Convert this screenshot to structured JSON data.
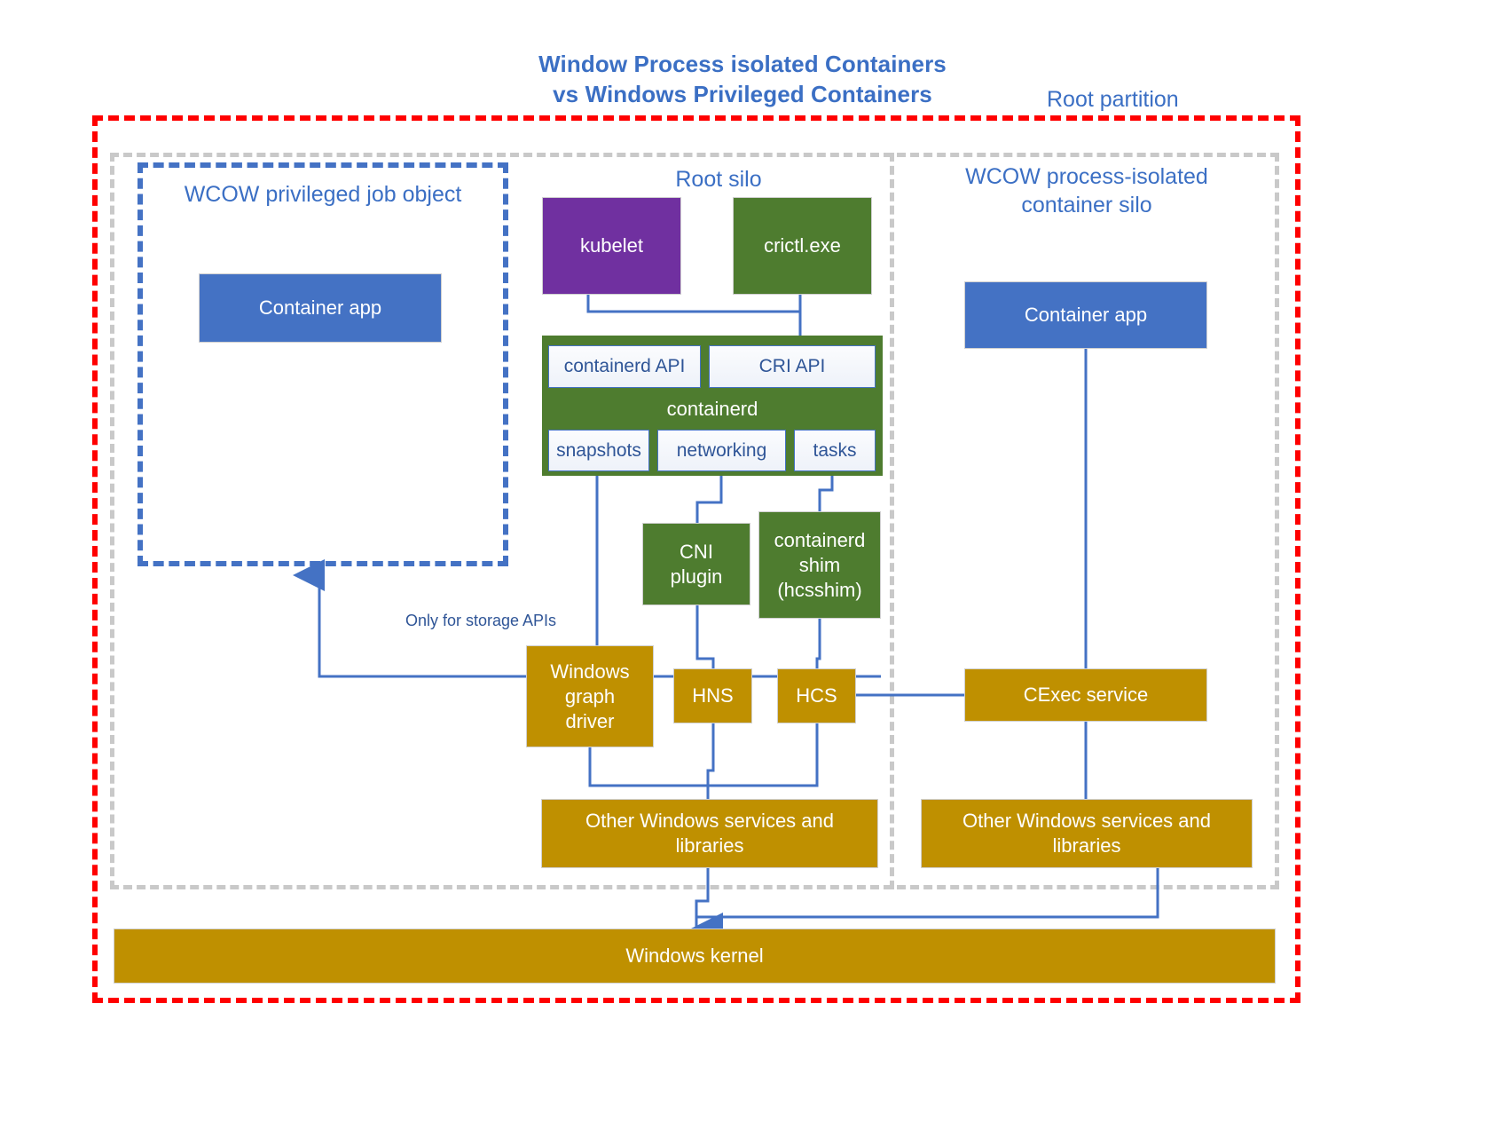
{
  "title": {
    "line1": "Window Process isolated Containers",
    "line2": "vs Windows Privileged Containers"
  },
  "partitions": {
    "root_partition_label": "Root partition",
    "job_object_title": "WCOW privileged job object",
    "root_silo_title": "Root silo",
    "isolated_silo_title": "WCOW process-isolated\ncontainer silo"
  },
  "colors": {
    "accent_blue": "#4472c4",
    "title_blue": "#3b6fc4",
    "purple": "#7030a0",
    "green": "#4e7c2f",
    "gold": "#bf9000",
    "red_dash": "#ff0000",
    "gray_dash": "#c9c9c9",
    "connector": "#4472c4"
  },
  "boxes": {
    "container_app_left": "Container app",
    "kubelet": "kubelet",
    "crictl": "crictl.exe",
    "containerd": "containerd",
    "containerd_api": "containerd API",
    "cri_api": "CRI API",
    "snapshots": "snapshots",
    "networking": "networking",
    "tasks": "tasks",
    "cni_plugin": "CNI\nplugin",
    "containerd_shim": "containerd\nshim\n(hcsshim)",
    "windows_graph_driver": "Windows\ngraph\ndriver",
    "hns": "HNS",
    "hcs": "HCS",
    "other_services_left": "Other Windows services and\nlibraries",
    "container_app_right": "Container app",
    "cexec_service": "CExec service",
    "other_services_right": "Other Windows services and\nlibraries",
    "windows_kernel": "Windows kernel"
  },
  "annotations": {
    "storage_apis": "Only for storage APIs"
  },
  "chart_data": {
    "type": "diagram",
    "title": "Window Process isolated Containers vs Windows Privileged Containers",
    "nodes": [
      {
        "id": "container_app_left",
        "label": "Container app",
        "group": "WCOW privileged job object",
        "color": "#4472c4"
      },
      {
        "id": "kubelet",
        "label": "kubelet",
        "group": "Root silo",
        "color": "#7030a0"
      },
      {
        "id": "crictl",
        "label": "crictl.exe",
        "group": "Root silo",
        "color": "#4e7c2f"
      },
      {
        "id": "containerd",
        "label": "containerd",
        "group": "Root silo",
        "color": "#4e7c2f"
      },
      {
        "id": "containerd_api",
        "label": "containerd API",
        "group": "containerd",
        "color": "#eef2f9"
      },
      {
        "id": "cri_api",
        "label": "CRI API",
        "group": "containerd",
        "color": "#eef2f9"
      },
      {
        "id": "snapshots",
        "label": "snapshots",
        "group": "containerd",
        "color": "#eef2f9"
      },
      {
        "id": "networking",
        "label": "networking",
        "group": "containerd",
        "color": "#eef2f9"
      },
      {
        "id": "tasks",
        "label": "tasks",
        "group": "containerd",
        "color": "#eef2f9"
      },
      {
        "id": "cni_plugin",
        "label": "CNI plugin",
        "group": "Root silo",
        "color": "#4e7c2f"
      },
      {
        "id": "containerd_shim",
        "label": "containerd shim (hcsshim)",
        "group": "Root silo",
        "color": "#4e7c2f"
      },
      {
        "id": "windows_graph_driver",
        "label": "Windows graph driver",
        "group": "Root silo",
        "color": "#bf9000"
      },
      {
        "id": "hns",
        "label": "HNS",
        "group": "Root silo",
        "color": "#bf9000"
      },
      {
        "id": "hcs",
        "label": "HCS",
        "group": "Root silo",
        "color": "#bf9000"
      },
      {
        "id": "other_services_left",
        "label": "Other Windows services and libraries",
        "group": "Root silo",
        "color": "#bf9000"
      },
      {
        "id": "container_app_right",
        "label": "Container app",
        "group": "WCOW process-isolated container silo",
        "color": "#4472c4"
      },
      {
        "id": "cexec_service",
        "label": "CExec service",
        "group": "WCOW process-isolated container silo",
        "color": "#bf9000"
      },
      {
        "id": "other_services_right",
        "label": "Other Windows services and libraries",
        "group": "WCOW process-isolated container silo",
        "color": "#bf9000"
      },
      {
        "id": "windows_kernel",
        "label": "Windows kernel",
        "group": "Root partition",
        "color": "#bf9000"
      }
    ],
    "edges": [
      {
        "from": "kubelet",
        "to": "cri_api",
        "label": ""
      },
      {
        "from": "crictl",
        "to": "cri_api",
        "label": ""
      },
      {
        "from": "snapshots",
        "to": "windows_graph_driver",
        "label": ""
      },
      {
        "from": "snapshots",
        "to": "container_app_left",
        "label": "Only for storage APIs"
      },
      {
        "from": "networking",
        "to": "cni_plugin",
        "label": ""
      },
      {
        "from": "tasks",
        "to": "containerd_shim",
        "label": ""
      },
      {
        "from": "cni_plugin",
        "to": "hns",
        "label": ""
      },
      {
        "from": "containerd_shim",
        "to": "hcs",
        "label": ""
      },
      {
        "from": "windows_graph_driver",
        "to": "other_services_left",
        "label": ""
      },
      {
        "from": "hns",
        "to": "other_services_left",
        "label": ""
      },
      {
        "from": "hcs",
        "to": "other_services_left",
        "label": ""
      },
      {
        "from": "hcs",
        "to": "cexec_service",
        "label": ""
      },
      {
        "from": "container_app_right",
        "to": "cexec_service",
        "label": ""
      },
      {
        "from": "cexec_service",
        "to": "other_services_right",
        "label": ""
      },
      {
        "from": "other_services_left",
        "to": "windows_kernel",
        "label": ""
      },
      {
        "from": "other_services_right",
        "to": "windows_kernel",
        "label": ""
      }
    ]
  }
}
